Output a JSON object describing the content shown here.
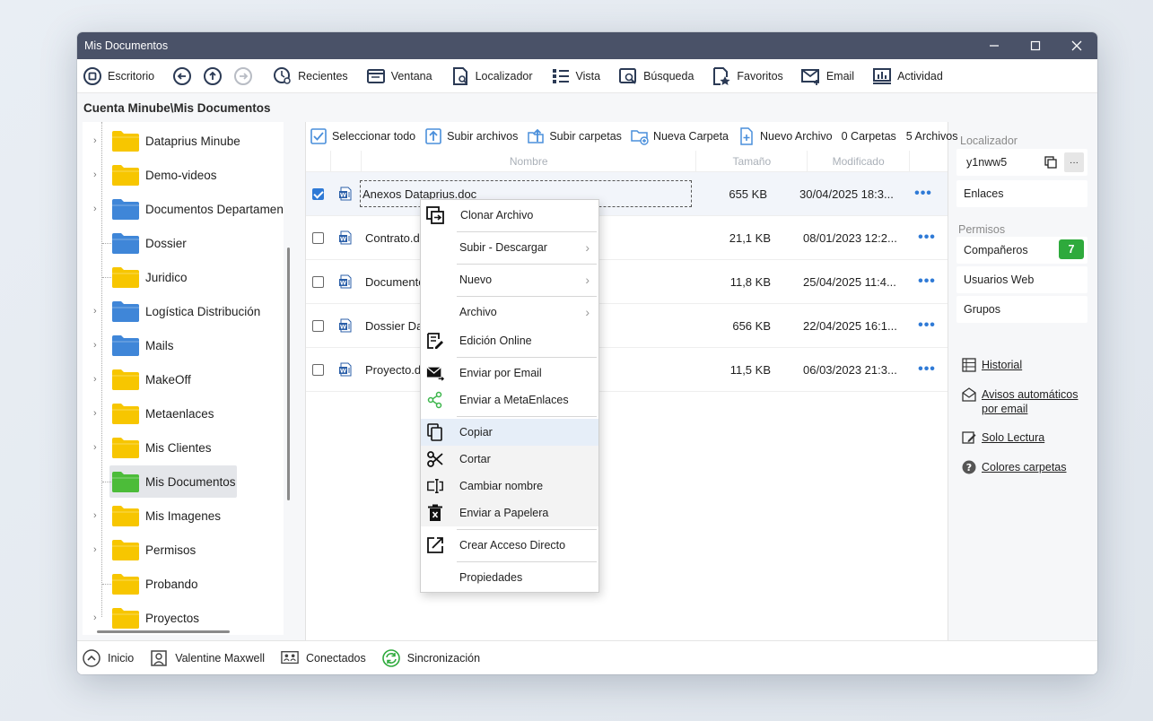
{
  "window": {
    "title": "Mis Documentos"
  },
  "toolbar": {
    "items": [
      "Escritorio",
      "Recientes",
      "Ventana",
      "Localizador",
      "Vista",
      "Búsqueda",
      "Favoritos",
      "Email",
      "Actividad"
    ]
  },
  "path": "Cuenta Minube\\Mis Documentos",
  "tree": {
    "items": [
      {
        "label": "Dataprius Minube",
        "color": "yellow",
        "expand": true
      },
      {
        "label": "Demo-videos",
        "color": "yellow",
        "expand": true
      },
      {
        "label": "Documentos Departament",
        "color": "blue",
        "expand": true
      },
      {
        "label": "Dossier",
        "color": "blue",
        "expand": false
      },
      {
        "label": "Juridico",
        "color": "yellow",
        "expand": false
      },
      {
        "label": "Logística Distribución",
        "color": "blue",
        "expand": true
      },
      {
        "label": "Mails",
        "color": "blue",
        "expand": true
      },
      {
        "label": "MakeOff",
        "color": "yellow",
        "expand": true
      },
      {
        "label": "Metaenlaces",
        "color": "yellow",
        "expand": true
      },
      {
        "label": "Mis Clientes",
        "color": "yellow",
        "expand": true
      },
      {
        "label": "Mis Documentos",
        "color": "green",
        "expand": false,
        "selected": true
      },
      {
        "label": "Mis Imagenes",
        "color": "yellow",
        "expand": true
      },
      {
        "label": "Permisos",
        "color": "yellow",
        "expand": true
      },
      {
        "label": "Probando",
        "color": "yellow",
        "expand": false
      },
      {
        "label": "Proyectos",
        "color": "yellow",
        "expand": true
      }
    ]
  },
  "filetool": {
    "select_all": "Seleccionar todo",
    "upload_files": "Subir archivos",
    "upload_folders": "Subir carpetas",
    "new_folder": "Nueva Carpeta",
    "new_file": "Nuevo Archivo",
    "folders_count": "0 Carpetas",
    "files_count": "5 Archivos"
  },
  "columns": {
    "name": "Nombre",
    "size": "Tamaño",
    "modified": "Modificado"
  },
  "files": [
    {
      "name": "Anexos Dataprius.doc",
      "size": "655 KB",
      "modified": "30/04/2025 18:3...",
      "checked": true
    },
    {
      "name": "Contrato.d",
      "size": "21,1 KB",
      "modified": "08/01/2023 12:2...",
      "checked": false
    },
    {
      "name": "Documento",
      "size": "11,8 KB",
      "modified": "25/04/2025 11:4...",
      "checked": false
    },
    {
      "name": "Dossier Da",
      "size": "656 KB",
      "modified": "22/04/2025 16:1...",
      "checked": false
    },
    {
      "name": "Proyecto.d",
      "size": "11,5 KB",
      "modified": "06/03/2023 21:3...",
      "checked": false
    }
  ],
  "context_menu": {
    "items": [
      "Clonar Archivo",
      "Subir - Descargar",
      "Nuevo",
      "Archivo",
      "Edición Online",
      "Enviar por Email",
      "Enviar a MetaEnlaces",
      "Copiar",
      "Cortar",
      "Cambiar nombre",
      "Enviar a Papelera",
      "Crear Acceso Directo",
      "Propiedades"
    ]
  },
  "right_panel": {
    "localizador_label": "Localizador",
    "localizador_value": "y1nww5",
    "links_label": "Enlaces",
    "permisos_label": "Permisos",
    "companeros": "Compañeros",
    "companeros_count": "7",
    "usuarios_web": "Usuarios Web",
    "grupos": "Grupos",
    "historial": "Historial",
    "avisos_1": "Avisos automáticos",
    "avisos_2": "por email",
    "solo_lectura": "Solo Lectura",
    "colores": "Colores carpetas"
  },
  "statusbar": {
    "inicio": "Inicio",
    "user": "Valentine Maxwell",
    "conectados": "Conectados",
    "sync": "Sincronización"
  },
  "colors": {
    "accent": "#2f7ad6",
    "titlebar": "#4a5268",
    "badge": "#2eaa3c",
    "folder_yellow": "#f7c600",
    "folder_blue": "#3f86d8",
    "folder_green": "#4cbc3a"
  }
}
